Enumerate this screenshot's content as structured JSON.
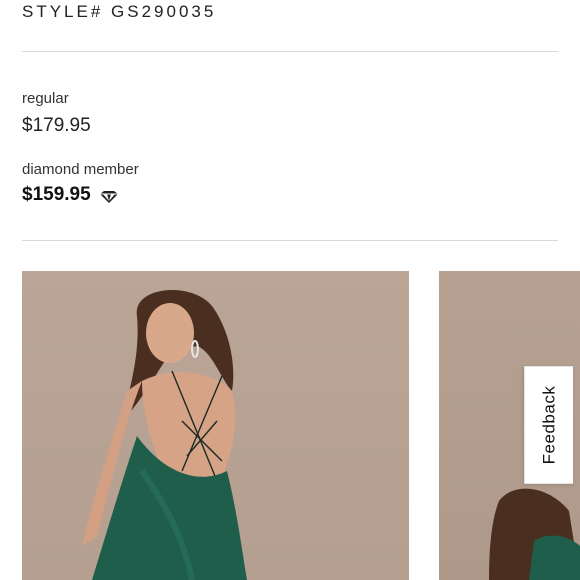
{
  "product": {
    "style_number": "STYLE# GS290035"
  },
  "pricing": {
    "regular_label": "regular",
    "regular_price": "$179.95",
    "member_label": "diamond member",
    "member_price": "$159.95",
    "member_icon": "diamond-icon"
  },
  "gallery": {
    "images": [
      {
        "subject": "woman-in-green-backless-satin-dress"
      },
      {
        "subject": "woman-in-green-satin-dress-partial"
      }
    ]
  },
  "feedback": {
    "label": "Feedback"
  },
  "colors": {
    "dress_green": "#1f5e4a",
    "photo_background": "#baa596"
  }
}
